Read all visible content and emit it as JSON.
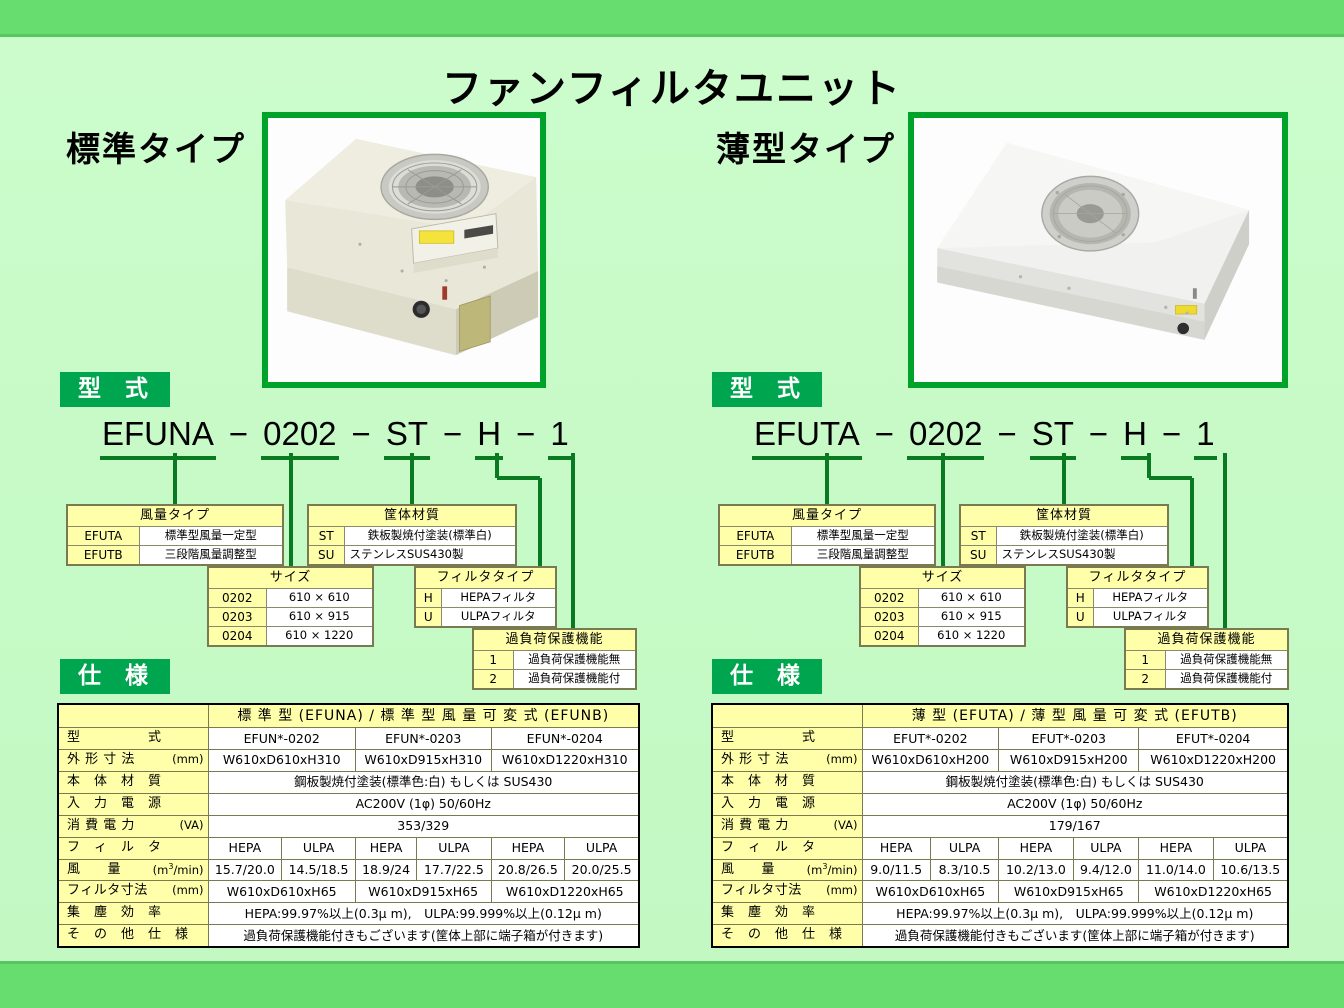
{
  "page": {
    "title": "ファンフィルタユニット",
    "bg_outer": "#66dd6e",
    "bg_inner": "#c8fac8",
    "accent_green": "#00a32a",
    "badge_green": "#00a550",
    "legend_header_bg": "#ffffaa"
  },
  "sections": {
    "model_badge": "型 式",
    "spec_badge": "仕 様"
  },
  "standard": {
    "type_label": "標準タイプ",
    "photo_name": "standard-ffu-photo",
    "code": {
      "prefix": "EFUNA",
      "size": "0202",
      "material": "ST",
      "filter": "H",
      "overload": "1",
      "dash": "−"
    },
    "legend_airflow": {
      "header": "風量タイプ",
      "rows": [
        {
          "key": "EFUTA",
          "value": "標準型風量一定型"
        },
        {
          "key": "EFUTB",
          "value": "三段階風量調整型"
        }
      ]
    },
    "legend_material": {
      "header": "筐体材質",
      "rows": [
        {
          "key": "ST",
          "value": "鉄板製焼付塗装(標準白)"
        },
        {
          "key": "SU",
          "value": "ステンレスSUS430製"
        }
      ]
    },
    "legend_size": {
      "header": "サイズ",
      "rows": [
        {
          "key": "0202",
          "value": "610 × 610"
        },
        {
          "key": "0203",
          "value": "610 × 915"
        },
        {
          "key": "0204",
          "value": "610 × 1220"
        }
      ]
    },
    "legend_filter": {
      "header": "フィルタタイプ",
      "rows": [
        {
          "key": "H",
          "value": "HEPAフィルタ"
        },
        {
          "key": "U",
          "value": "ULPAフィルタ"
        }
      ]
    },
    "legend_overload": {
      "header": "過負荷保護機能",
      "rows": [
        {
          "key": "1",
          "value": "過負荷保護機能無"
        },
        {
          "key": "2",
          "value": "過負荷保護機能付"
        }
      ]
    },
    "spec": {
      "top_header": "標 準 型 (EFUNA) / 標 準 型 風 量 可 変 式 (EFUNB)",
      "row_model": {
        "label": "型　　　　　式",
        "values": [
          "EFUN*-0202",
          "EFUN*-0203",
          "EFUN*-0204"
        ]
      },
      "row_dims": {
        "label": "外 形 寸 法",
        "unit": "(mm)",
        "values": [
          "W610xD610xH310",
          "W610xD915xH310",
          "W610xD1220xH310"
        ]
      },
      "row_body": {
        "label": "本　体　材　質",
        "value": "鋼板製焼付塗装(標準色:白) もしくは SUS430"
      },
      "row_power": {
        "label": "入　力　電　源",
        "value": "AC200V (1φ) 50/60Hz"
      },
      "row_consumption": {
        "label": "消 費 電 力",
        "unit": "(VA)",
        "value": "353/329"
      },
      "row_filter": {
        "label": "フ　ィ　ル　タ",
        "values": [
          "HEPA",
          "ULPA",
          "HEPA",
          "ULPA",
          "HEPA",
          "ULPA"
        ]
      },
      "row_airflow": {
        "label": "風　　量",
        "unit": "(m3/min)",
        "values": [
          "15.7/20.0",
          "14.5/18.5",
          "18.9/24",
          "17.7/22.5",
          "20.8/26.5",
          "20.0/25.5"
        ]
      },
      "row_filter_dims": {
        "label": "フィルタ寸法",
        "unit": "(mm)",
        "values": [
          "W610xD610xH65",
          "W610xD915xH65",
          "W610xD1220xH65"
        ]
      },
      "row_efficiency": {
        "label": "集　塵　効　率",
        "value": "HEPA:99.97%以上(0.3μ m),　ULPA:99.999%以上(0.12μ m)"
      },
      "row_other": {
        "label": "そ　の　他　仕　様",
        "value": "過負荷保護機能付きもございます(筐体上部に端子箱が付きます)"
      }
    }
  },
  "thin": {
    "type_label": "薄型タイプ",
    "photo_name": "thin-ffu-photo",
    "code": {
      "prefix": "EFUTA",
      "size": "0202",
      "material": "ST",
      "filter": "H",
      "overload": "1",
      "dash": "−"
    },
    "legend_airflow": {
      "header": "風量タイプ",
      "rows": [
        {
          "key": "EFUTA",
          "value": "標準型風量一定型"
        },
        {
          "key": "EFUTB",
          "value": "三段階風量調整型"
        }
      ]
    },
    "legend_material": {
      "header": "筐体材質",
      "rows": [
        {
          "key": "ST",
          "value": "鉄板製焼付塗装(標準白)"
        },
        {
          "key": "SU",
          "value": "ステンレスSUS430製"
        }
      ]
    },
    "legend_size": {
      "header": "サイズ",
      "rows": [
        {
          "key": "0202",
          "value": "610 × 610"
        },
        {
          "key": "0203",
          "value": "610 × 915"
        },
        {
          "key": "0204",
          "value": "610 × 1220"
        }
      ]
    },
    "legend_filter": {
      "header": "フィルタタイプ",
      "rows": [
        {
          "key": "H",
          "value": "HEPAフィルタ"
        },
        {
          "key": "U",
          "value": "ULPAフィルタ"
        }
      ]
    },
    "legend_overload": {
      "header": "過負荷保護機能",
      "rows": [
        {
          "key": "1",
          "value": "過負荷保護機能無"
        },
        {
          "key": "2",
          "value": "過負荷保護機能付"
        }
      ]
    },
    "spec": {
      "top_header": "薄 型 (EFUTA) / 薄 型 風 量 可 変 式 (EFUTB)",
      "row_model": {
        "label": "型　　　　　式",
        "values": [
          "EFUT*-0202",
          "EFUT*-0203",
          "EFUT*-0204"
        ]
      },
      "row_dims": {
        "label": "外 形 寸 法",
        "unit": "(mm)",
        "values": [
          "W610xD610xH200",
          "W610xD915xH200",
          "W610xD1220xH200"
        ]
      },
      "row_body": {
        "label": "本　体　材　質",
        "value": "鋼板製焼付塗装(標準色:白) もしくは SUS430"
      },
      "row_power": {
        "label": "入　力　電　源",
        "value": "AC200V (1φ) 50/60Hz"
      },
      "row_consumption": {
        "label": "消 費 電 力",
        "unit": "(VA)",
        "value": "179/167"
      },
      "row_filter": {
        "label": "フ　ィ　ル　タ",
        "values": [
          "HEPA",
          "ULPA",
          "HEPA",
          "ULPA",
          "HEPA",
          "ULPA"
        ]
      },
      "row_airflow": {
        "label": "風　　量",
        "unit": "(m3/min)",
        "values": [
          "9.0/11.5",
          "8.3/10.5",
          "10.2/13.0",
          "9.4/12.0",
          "11.0/14.0",
          "10.6/13.5"
        ]
      },
      "row_filter_dims": {
        "label": "フィルタ寸法",
        "unit": "(mm)",
        "values": [
          "W610xD610xH65",
          "W610xD915xH65",
          "W610xD1220xH65"
        ]
      },
      "row_efficiency": {
        "label": "集　塵　効　率",
        "value": "HEPA:99.97%以上(0.3μ m),　ULPA:99.999%以上(0.12μ m)"
      },
      "row_other": {
        "label": "そ　の　他　仕　様",
        "value": "過負荷保護機能付きもございます(筐体上部に端子箱が付きます)"
      }
    }
  }
}
